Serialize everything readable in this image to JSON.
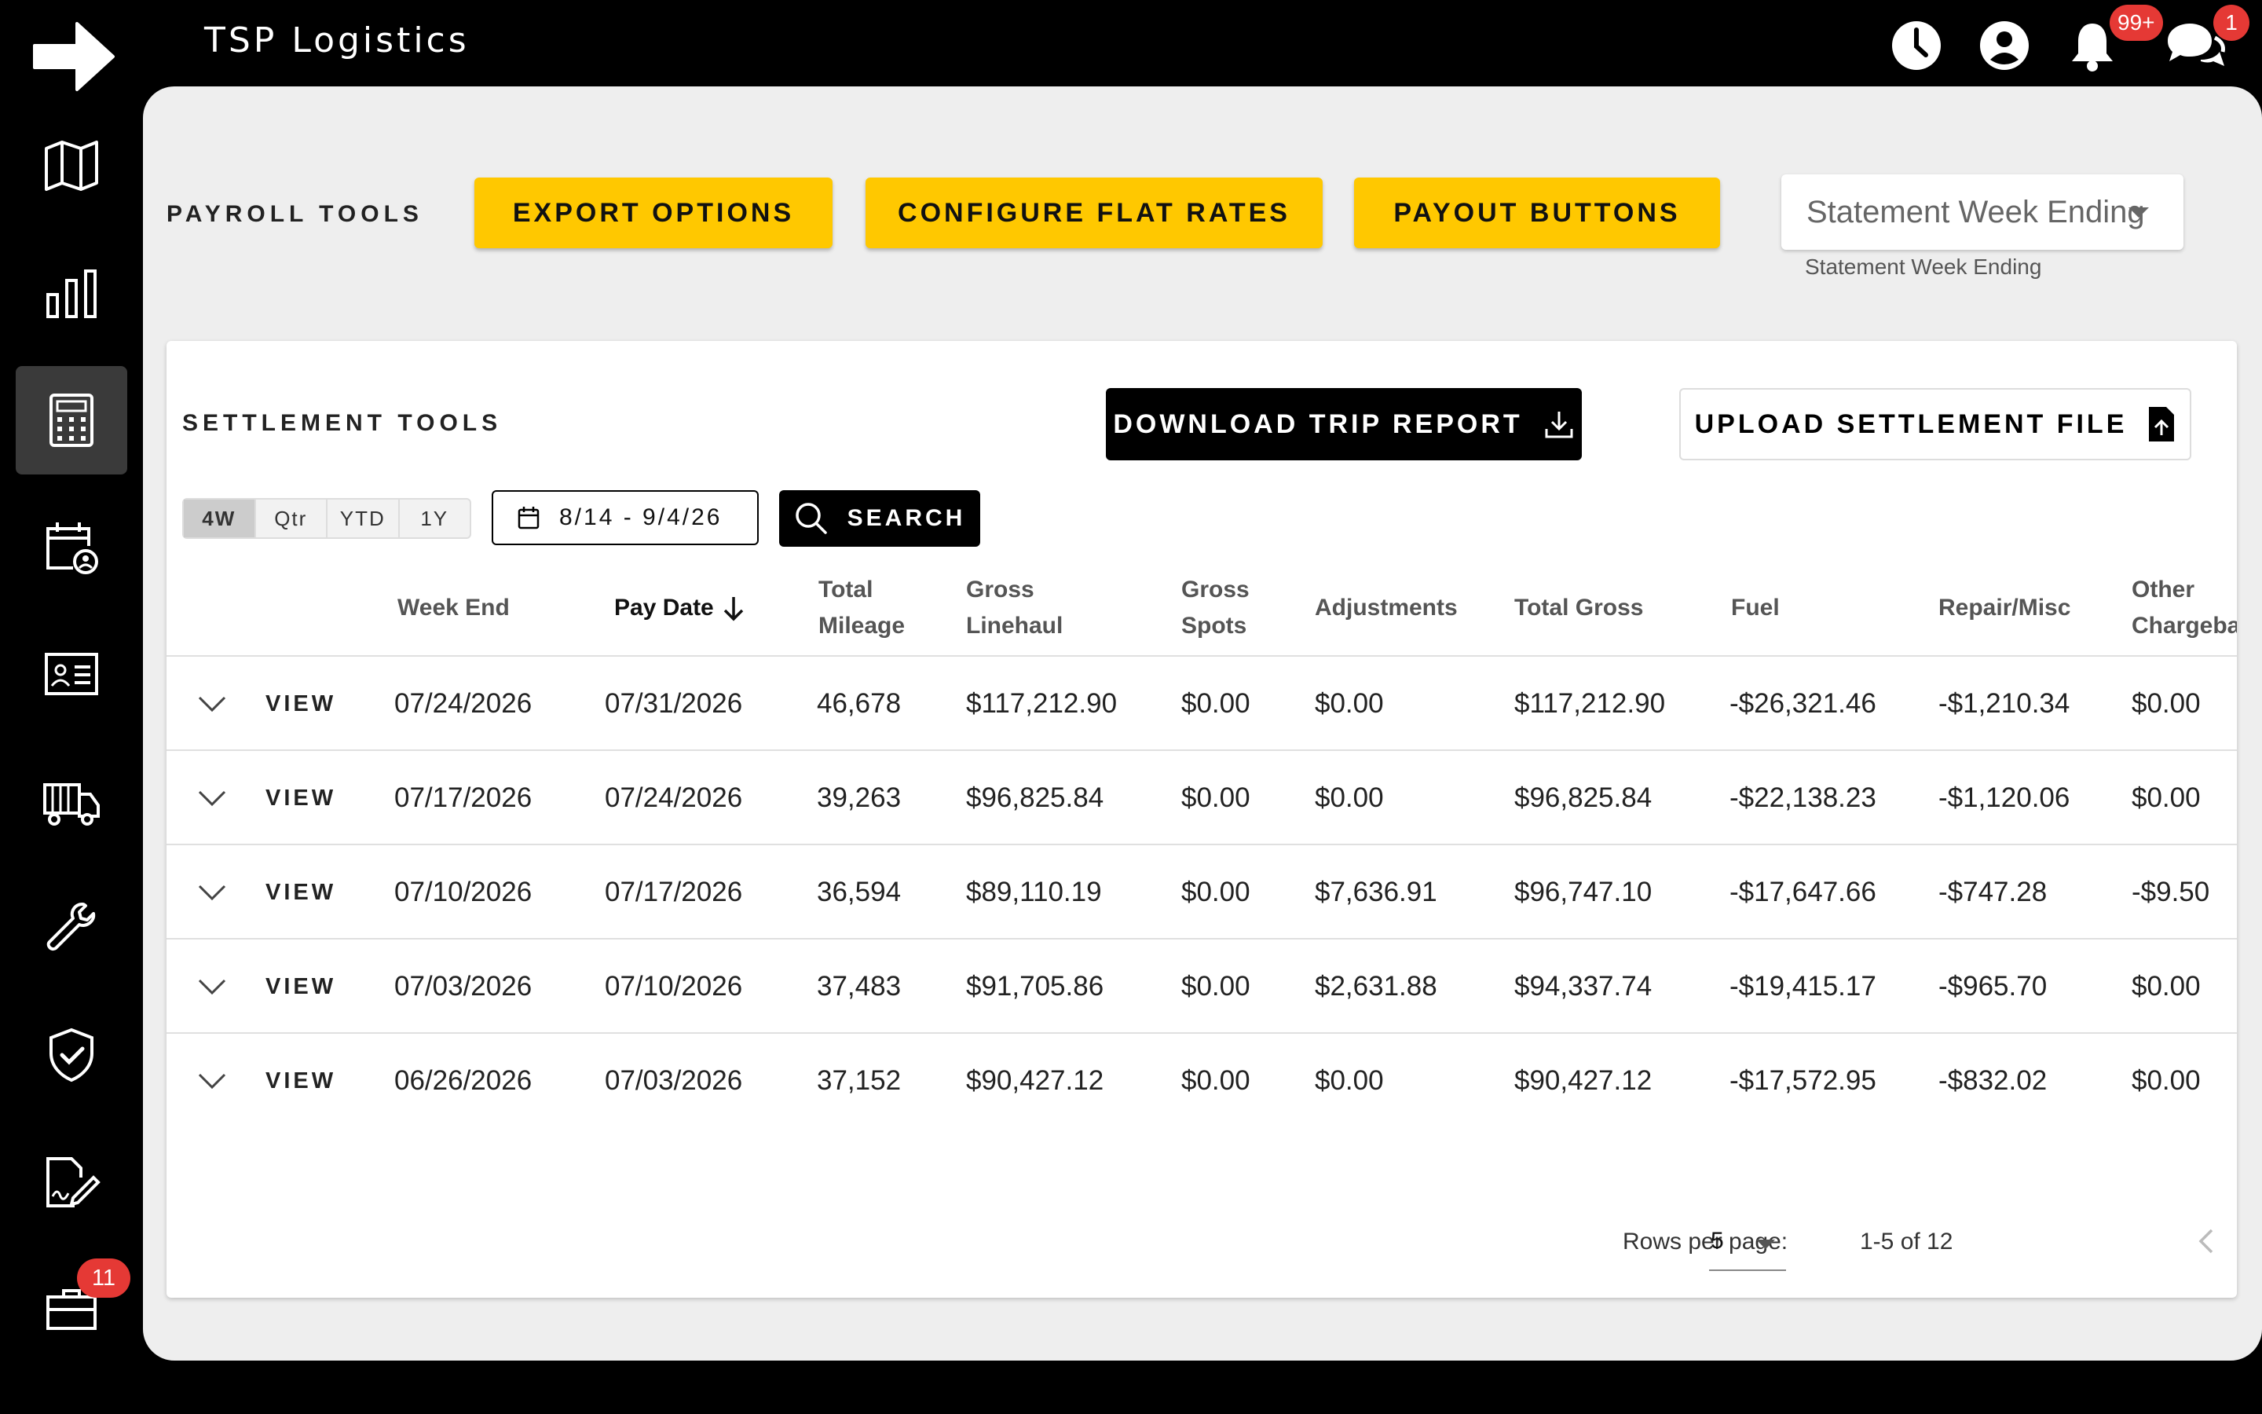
{
  "app": {
    "title": "TSP Logistics"
  },
  "topbar": {
    "icons": [
      "clock-icon",
      "account-icon",
      "bell-icon",
      "chat-icon"
    ],
    "notifications_badge": "99+",
    "messages_badge": "1"
  },
  "sidebar": {
    "items": [
      {
        "icon": "map-icon"
      },
      {
        "icon": "bar-chart-icon"
      },
      {
        "icon": "calculator-icon",
        "active": true
      },
      {
        "icon": "calendar-user-icon"
      },
      {
        "icon": "id-card-icon"
      },
      {
        "icon": "truck-icon"
      },
      {
        "icon": "wrench-icon"
      },
      {
        "icon": "shield-check-icon"
      },
      {
        "icon": "document-sign-icon"
      },
      {
        "icon": "briefcase-icon",
        "badge": "11"
      }
    ]
  },
  "payroll": {
    "title": "PAYROLL TOOLS",
    "buttons": {
      "export": "EXPORT OPTIONS",
      "flat_rates": "CONFIGURE FLAT RATES",
      "payout": "PAYOUT BUTTONS"
    },
    "dropdown": {
      "value": "Statement Week Ending",
      "helper": "Statement Week Ending"
    }
  },
  "settlement": {
    "title": "SETTLEMENT TOOLS",
    "download_label": "DOWNLOAD TRIP REPORT",
    "upload_label": "UPLOAD SETTLEMENT FILE",
    "ranges": [
      "4W",
      "Qtr",
      "YTD",
      "1Y"
    ],
    "selected_range": "4W",
    "date_range": "8/14 - 9/4/26",
    "search_label": "SEARCH",
    "columns": {
      "week_end": "Week End",
      "pay_date": "Pay Date",
      "total_mileage": "Total\nMileage",
      "gross_linehaul": "Gross\nLinehaul",
      "gross_spots": "Gross\nSpots",
      "adjustments": "Adjustments",
      "total_gross": "Total Gross",
      "fuel": "Fuel",
      "repair_misc": "Repair/Misc",
      "other_chargebacks": "Other\nChargebacks"
    },
    "view_label": "VIEW",
    "rows": [
      {
        "week_end": "07/24/2026",
        "pay_date": "07/31/2026",
        "total_mileage": "46,678",
        "gross_linehaul": "$117,212.90",
        "gross_spots": "$0.00",
        "adjustments": "$0.00",
        "total_gross": "$117,212.90",
        "fuel": "-$26,321.46",
        "repair_misc": "-$1,210.34",
        "other_chargebacks": "$0.00"
      },
      {
        "week_end": "07/17/2026",
        "pay_date": "07/24/2026",
        "total_mileage": "39,263",
        "gross_linehaul": "$96,825.84",
        "gross_spots": "$0.00",
        "adjustments": "$0.00",
        "total_gross": "$96,825.84",
        "fuel": "-$22,138.23",
        "repair_misc": "-$1,120.06",
        "other_chargebacks": "$0.00"
      },
      {
        "week_end": "07/10/2026",
        "pay_date": "07/17/2026",
        "total_mileage": "36,594",
        "gross_linehaul": "$89,110.19",
        "gross_spots": "$0.00",
        "adjustments": "$7,636.91",
        "total_gross": "$96,747.10",
        "fuel": "-$17,647.66",
        "repair_misc": "-$747.28",
        "other_chargebacks": "-$9.50"
      },
      {
        "week_end": "07/03/2026",
        "pay_date": "07/10/2026",
        "total_mileage": "37,483",
        "gross_linehaul": "$91,705.86",
        "gross_spots": "$0.00",
        "adjustments": "$2,631.88",
        "total_gross": "$94,337.74",
        "fuel": "-$19,415.17",
        "repair_misc": "-$965.70",
        "other_chargebacks": "$0.00"
      },
      {
        "week_end": "06/26/2026",
        "pay_date": "07/03/2026",
        "total_mileage": "37,152",
        "gross_linehaul": "$90,427.12",
        "gross_spots": "$0.00",
        "adjustments": "$0.00",
        "total_gross": "$90,427.12",
        "fuel": "-$17,572.95",
        "repair_misc": "-$832.02",
        "other_chargebacks": "$0.00"
      }
    ],
    "pagination": {
      "rows_per_page_label": "Rows per page:",
      "rows_per_page": "5",
      "range_text": "1-5 of 12"
    }
  }
}
